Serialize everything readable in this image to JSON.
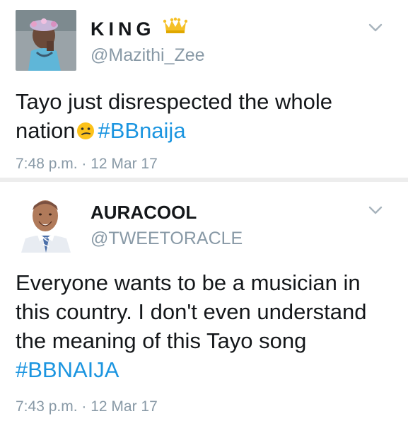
{
  "tweets": [
    {
      "display_name": "KING",
      "handle": "@Mazithi_Zee",
      "text_before": "Tayo just disrespected the whole nation",
      "emoji": "confused-face-emoji",
      "hashtag": "#BBnaija",
      "timestamp": "7:48 p.m. · 12 Mar 17",
      "badge": "crown-emoji"
    },
    {
      "display_name": "AURACOOL",
      "handle": "@TWEETORACLE",
      "text": "Everyone wants to be a musician in this country. I don't even understand the meaning of this Tayo song",
      "hashtag": "#BBNAIJA",
      "timestamp": "7:43 p.m. · 12 Mar 17"
    }
  ],
  "colors": {
    "hashtag": "#1b95e0",
    "secondary_text": "#8899a6",
    "primary_text": "#14171a",
    "separator": "#ededed"
  }
}
